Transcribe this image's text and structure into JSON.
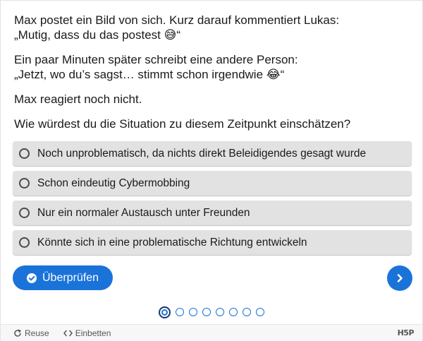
{
  "story": {
    "p1_line1": "Max postet ein Bild von sich. Kurz darauf kommentiert Lukas:",
    "p1_line2": "„Mutig, dass du das postest 😅“",
    "p2_line1": "Ein paar Minuten später schreibt eine andere Person:",
    "p2_line2": "„Jetzt, wo du’s sagst… stimmt schon irgendwie 😂“",
    "p3": "Max reagiert noch nicht."
  },
  "question": "Wie würdest du die Situation zu diesem Zeitpunkt einschätzen?",
  "options": [
    {
      "label": "Noch unproblematisch, da nichts direkt Beleidigendes gesagt wurde"
    },
    {
      "label": "Schon eindeutig Cybermobbing"
    },
    {
      "label": "Nur ein normaler Austausch unter Freunden"
    },
    {
      "label": "Könnte sich in eine problematische Richtung entwickeln"
    }
  ],
  "actions": {
    "check_label": "Überprüfen",
    "check_icon": "check-circle-icon",
    "next_icon": "chevron-right-icon"
  },
  "pagination": {
    "total": 8,
    "current": 1
  },
  "footer": {
    "reuse_label": "Reuse",
    "embed_label": "Einbetten",
    "logo_text": "H5P"
  },
  "colors": {
    "accent": "#1a73d9",
    "option_bg": "#e2e2e2",
    "footer_bg": "#f7f7f7"
  }
}
